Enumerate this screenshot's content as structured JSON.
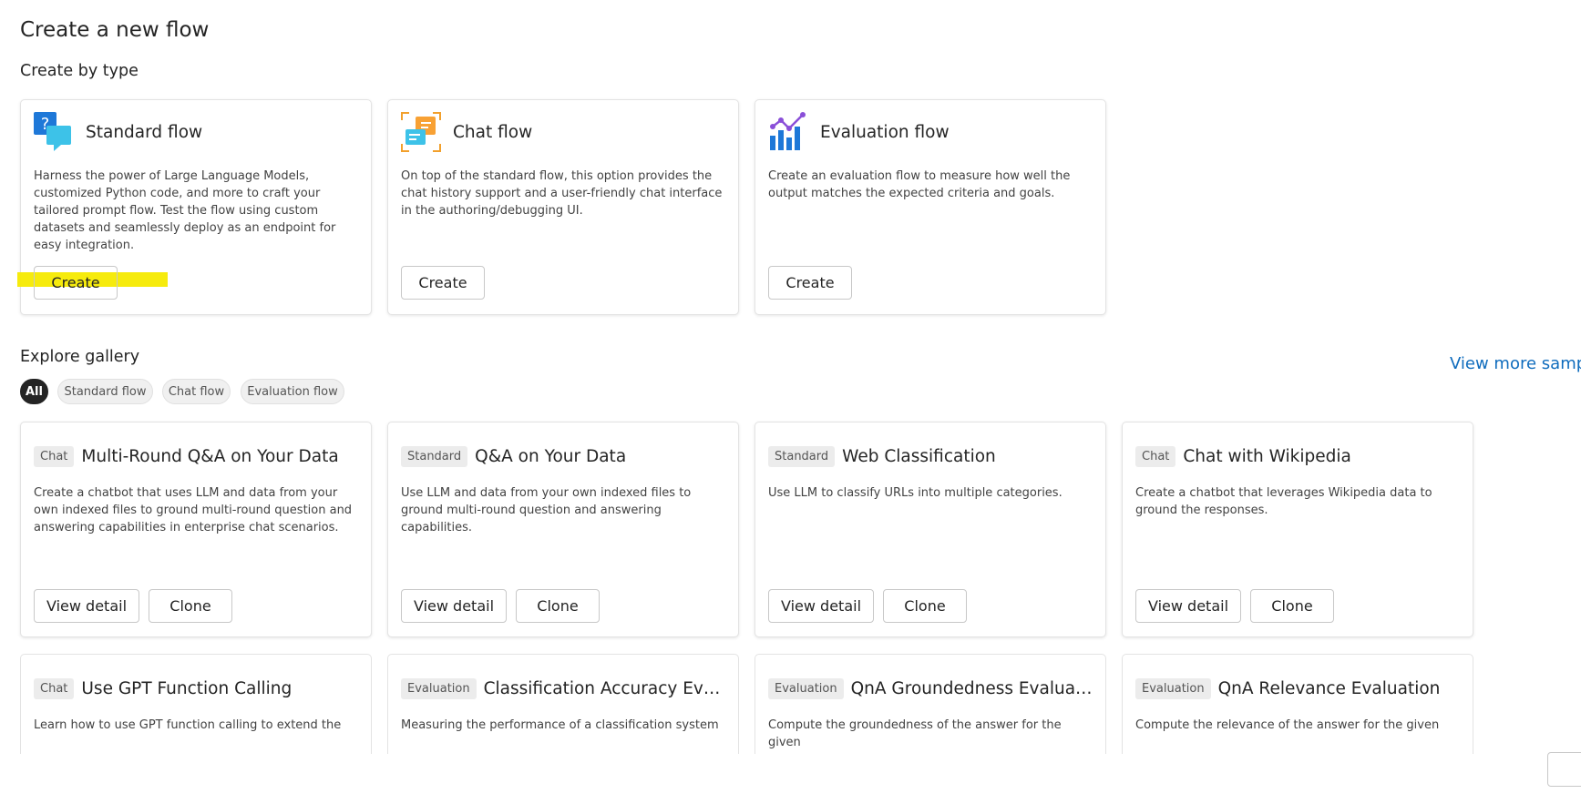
{
  "page": {
    "title": "Create a new flow",
    "create_by_type": "Create by type",
    "explore_gallery": "Explore gallery",
    "view_more": "View more samp"
  },
  "type_cards": [
    {
      "title": "Standard flow",
      "icon": "standard-flow-icon",
      "desc": "Harness the power of Large Language Models, customized Python code, and more to craft your tailored prompt flow. Test the flow using custom datasets and seamlessly deploy as an endpoint for easy integration.",
      "button": "Create"
    },
    {
      "title": "Chat flow",
      "icon": "chat-flow-icon",
      "desc": "On top of the standard flow, this option provides the chat history support and a user-friendly chat interface in the authoring/debugging UI.",
      "button": "Create"
    },
    {
      "title": "Evaluation flow",
      "icon": "evaluation-flow-icon",
      "desc": "Create an evaluation flow to measure how well the output matches the expected criteria and goals.",
      "button": "Create"
    }
  ],
  "filters": [
    "All",
    "Standard flow",
    "Chat flow",
    "Evaluation flow"
  ],
  "gallery_actions": {
    "view_detail": "View detail",
    "clone": "Clone"
  },
  "gallery": [
    {
      "tag": "Chat",
      "title": "Multi-Round Q&A on Your Data",
      "desc": "Create a chatbot that uses LLM and data from your own indexed files to ground multi-round question and answering capabilities in enterprise chat scenarios."
    },
    {
      "tag": "Standard",
      "title": "Q&A on Your Data",
      "desc": "Use LLM and data from your own indexed files to ground multi-round question and answering capabilities."
    },
    {
      "tag": "Standard",
      "title": "Web Classification",
      "desc": "Use LLM to classify URLs into multiple categories."
    },
    {
      "tag": "Chat",
      "title": "Chat with Wikipedia",
      "desc": "Create a chatbot that leverages Wikipedia data to ground the responses."
    },
    {
      "tag": "Chat",
      "title": "Use GPT Function Calling",
      "desc": "Learn how to use GPT function calling to extend the"
    },
    {
      "tag": "Evaluation",
      "title": "Classification Accuracy Evalu...",
      "desc": "Measuring the performance of a classification system"
    },
    {
      "tag": "Evaluation",
      "title": "QnA Groundedness Evaluation",
      "desc": "Compute the groundedness of the answer for the given"
    },
    {
      "tag": "Evaluation",
      "title": "QnA Relevance Evaluation",
      "desc": "Compute the relevance of the answer for the given"
    }
  ],
  "colors": {
    "accent_link": "#0f6cbd",
    "highlight": "#f6ea00",
    "active_pill": "#242424"
  }
}
